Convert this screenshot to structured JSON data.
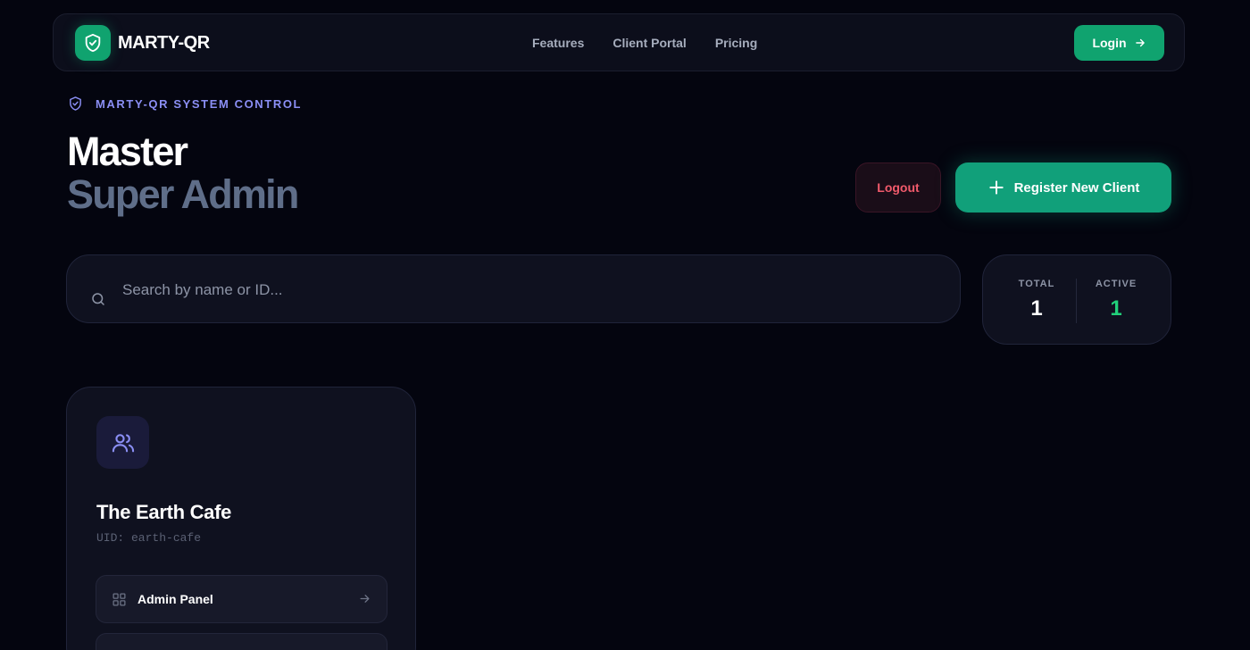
{
  "nav": {
    "brand": "MARTY-QR",
    "links": [
      {
        "label": "Features"
      },
      {
        "label": "Client Portal"
      },
      {
        "label": "Pricing"
      }
    ],
    "login_label": "Login"
  },
  "header": {
    "eyebrow": "MARTY-QR SYSTEM CONTROL",
    "title_line1": "Master",
    "title_line2": "Super Admin",
    "logout_label": "Logout",
    "register_label": "Register New Client"
  },
  "search": {
    "placeholder": "Search by name or ID..."
  },
  "stats": {
    "total_label": "TOTAL",
    "total_value": "1",
    "active_label": "ACTIVE",
    "active_value": "1"
  },
  "clients": [
    {
      "name": "The Earth Cafe",
      "uid": "UID: earth-cafe",
      "actions": [
        {
          "label": "Admin Panel",
          "icon": "grid-icon"
        }
      ]
    }
  ],
  "colors": {
    "background": "#04050f",
    "accent_green": "#10a36f",
    "eyebrow_purple": "#8b8ff5",
    "logout_red": "#f15a6b",
    "active_green": "#21d07a"
  }
}
